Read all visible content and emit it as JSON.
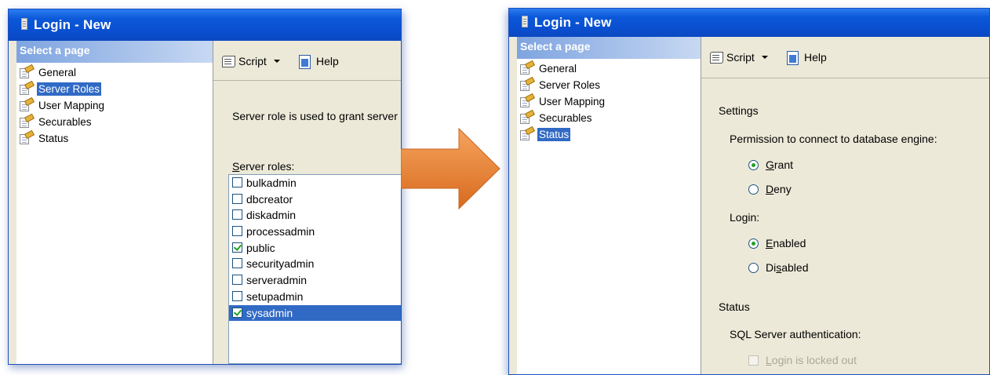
{
  "left_window": {
    "title": "Login - New",
    "sidebar": {
      "header": "Select a page",
      "items": [
        {
          "label": "General",
          "selected": false
        },
        {
          "label": "Server Roles",
          "selected": true
        },
        {
          "label": "User Mapping",
          "selected": false
        },
        {
          "label": "Securables",
          "selected": false
        },
        {
          "label": "Status",
          "selected": false
        }
      ]
    },
    "toolbar": {
      "script_label": "Script",
      "help_label": "Help"
    },
    "description": "Server role is used to grant server",
    "roles_label_access": "S",
    "roles_label_rest": "erver roles:",
    "roles": [
      {
        "name": "bulkadmin",
        "checked": false
      },
      {
        "name": "dbcreator",
        "checked": false
      },
      {
        "name": "diskadmin",
        "checked": false
      },
      {
        "name": "processadmin",
        "checked": false
      },
      {
        "name": "public",
        "checked": true
      },
      {
        "name": "securityadmin",
        "checked": false
      },
      {
        "name": "serveradmin",
        "checked": false
      },
      {
        "name": "setupadmin",
        "checked": false
      },
      {
        "name": "sysadmin",
        "checked": true,
        "selected": true
      }
    ]
  },
  "right_window": {
    "title": "Login - New",
    "sidebar": {
      "header": "Select a page",
      "items": [
        {
          "label": "General",
          "selected": false
        },
        {
          "label": "Server Roles",
          "selected": false
        },
        {
          "label": "User Mapping",
          "selected": false
        },
        {
          "label": "Securables",
          "selected": false
        },
        {
          "label": "Status",
          "selected": true
        }
      ]
    },
    "toolbar": {
      "script_label": "Script",
      "help_label": "Help"
    },
    "settings_heading": "Settings",
    "permission_label": "Permission to connect to database engine:",
    "grant": {
      "access": "G",
      "rest": "rant",
      "selected": true
    },
    "deny": {
      "access": "D",
      "rest": "eny",
      "selected": false
    },
    "login_label": "Login:",
    "enabled": {
      "access": "E",
      "rest": "nabled",
      "selected": true
    },
    "disabled": {
      "prefix": "Di",
      "access": "s",
      "rest": "abled",
      "selected": false
    },
    "status_heading": "Status",
    "sql_auth_label": "SQL Server authentication:",
    "locked_out": {
      "access": "L",
      "rest": "ogin is locked out",
      "enabled": false
    }
  },
  "colors": {
    "titlebar": "#0a4fd0",
    "selection": "#316ac5",
    "arrow": "#e8843a",
    "panel": "#ece9d8"
  }
}
